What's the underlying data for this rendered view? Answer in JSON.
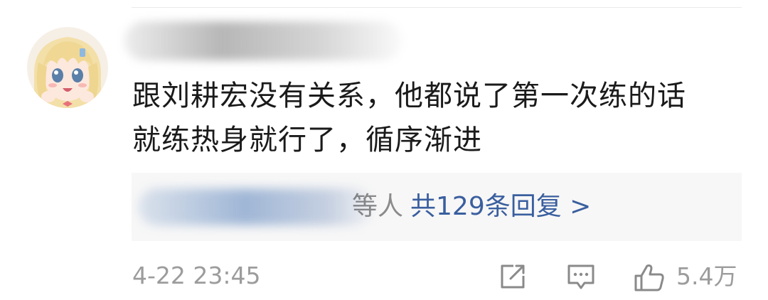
{
  "comment": {
    "author_name": "",
    "lines": [
      "跟刘耕宏没有关系，他都说了第一次练的话",
      "就练热身就行了，循序渐进"
    ]
  },
  "replies": {
    "suffix": "等人",
    "link": "共129条回复 >"
  },
  "meta": {
    "timestamp": "4-22 23:45",
    "likes": "5.4万"
  },
  "icons": {
    "share": "share-icon",
    "reply": "comment-icon",
    "like": "thumbs-up-icon"
  },
  "colors": {
    "text": "#1a1a1a",
    "link": "#3a5f9f",
    "meta": "#9c9c9c",
    "reply_bg": "#f7f7f7"
  }
}
